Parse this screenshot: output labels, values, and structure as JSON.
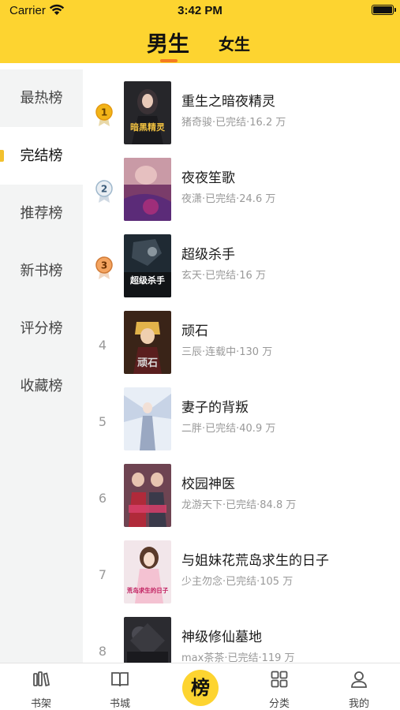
{
  "status_bar": {
    "carrier": "Carrier",
    "time": "3:42 PM"
  },
  "gender_tabs": {
    "male": "男生",
    "female": "女生",
    "active": "male"
  },
  "sidebar": {
    "active_index": 1,
    "items": [
      {
        "label": "最热榜"
      },
      {
        "label": "完结榜"
      },
      {
        "label": "推荐榜"
      },
      {
        "label": "新书榜"
      },
      {
        "label": "评分榜"
      },
      {
        "label": "收藏榜"
      }
    ]
  },
  "books": [
    {
      "rank": "1",
      "title": "重生之暗夜精灵",
      "meta": "猪奇骏·已完结·16.2 万",
      "cover_text": "暗黑精灵",
      "cover_color": "#2a2a2e"
    },
    {
      "rank": "2",
      "title": "夜夜笙歌",
      "meta": "夜潇·已完结·24.6 万",
      "cover_text": "",
      "cover_color": "#7a3c6a"
    },
    {
      "rank": "3",
      "title": "超级杀手",
      "meta": "玄天·已完结·16 万",
      "cover_text": "超级杀手",
      "cover_color": "#1f2a33"
    },
    {
      "rank": "4",
      "title": "顽石",
      "meta": "三辰·连载中·130 万",
      "cover_text": "顽石",
      "cover_color": "#3a2418"
    },
    {
      "rank": "5",
      "title": "妻子的背叛",
      "meta": "二胖·已完结·40.9 万",
      "cover_text": "",
      "cover_color": "#cfd8e8"
    },
    {
      "rank": "6",
      "title": "校园神医",
      "meta": "龙游天下·已完结·84.8 万",
      "cover_text": "",
      "cover_color": "#7a4a5a"
    },
    {
      "rank": "7",
      "title": "与姐妹花荒岛求生的日子",
      "meta": "少主勿念·已完结·105 万",
      "cover_text": "荒岛求生的日子",
      "cover_color": "#f2e6ea"
    },
    {
      "rank": "8",
      "title": "神级修仙墓地",
      "meta": "max茶茶·已完结·119 万",
      "cover_text": "",
      "cover_color": "#2b2b30"
    }
  ],
  "bottom_nav": {
    "items": [
      {
        "label": "书架",
        "icon": "bookshelf-icon"
      },
      {
        "label": "书城",
        "icon": "book-open-icon"
      },
      {
        "label": "榜",
        "icon": "ranking-icon"
      },
      {
        "label": "分类",
        "icon": "category-grid-icon"
      },
      {
        "label": "我的",
        "icon": "user-icon"
      }
    ]
  },
  "colors": {
    "accent": "#FDD430",
    "indicator": "#F47A20",
    "sidebar_bg": "#F3F4F4"
  }
}
